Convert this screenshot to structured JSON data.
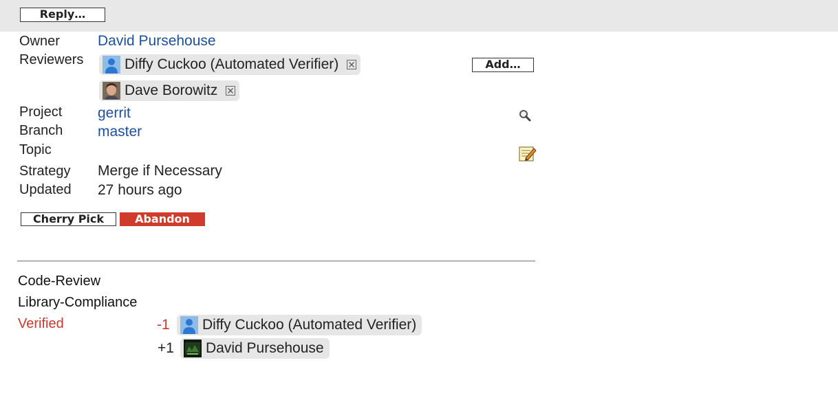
{
  "toolbar": {
    "reply_label": "Reply…"
  },
  "info": {
    "owner_label": "Owner",
    "owner_value": "David Pursehouse",
    "reviewers_label": "Reviewers",
    "reviewers": [
      {
        "name": "Diffy Cuckoo (Automated Verifier)",
        "avatar": "default-user-icon"
      },
      {
        "name": "Dave Borowitz",
        "avatar": "photo"
      }
    ],
    "add_reviewer_label": "Add…",
    "project_label": "Project",
    "project_value": "gerrit",
    "branch_label": "Branch",
    "branch_value": "master",
    "topic_label": "Topic",
    "strategy_label": "Strategy",
    "strategy_value": "Merge if Necessary",
    "updated_label": "Updated",
    "updated_value": "27 hours ago"
  },
  "actions": {
    "cherry_pick_label": "Cherry Pick",
    "abandon_label": "Abandon"
  },
  "labels": {
    "code_review": "Code-Review",
    "library_compliance": "Library-Compliance",
    "verified": "Verified",
    "votes": [
      {
        "score": "-1",
        "name": "Diffy Cuckoo (Automated Verifier)",
        "avatar": "default-user-icon"
      },
      {
        "score": "+1",
        "name": "David Pursehouse",
        "avatar": "photo"
      }
    ]
  },
  "colors": {
    "link": "#1c4f9c",
    "abandon": "#d13b2c",
    "verified": "#c9392b",
    "topbar": "#e8e8e8"
  }
}
